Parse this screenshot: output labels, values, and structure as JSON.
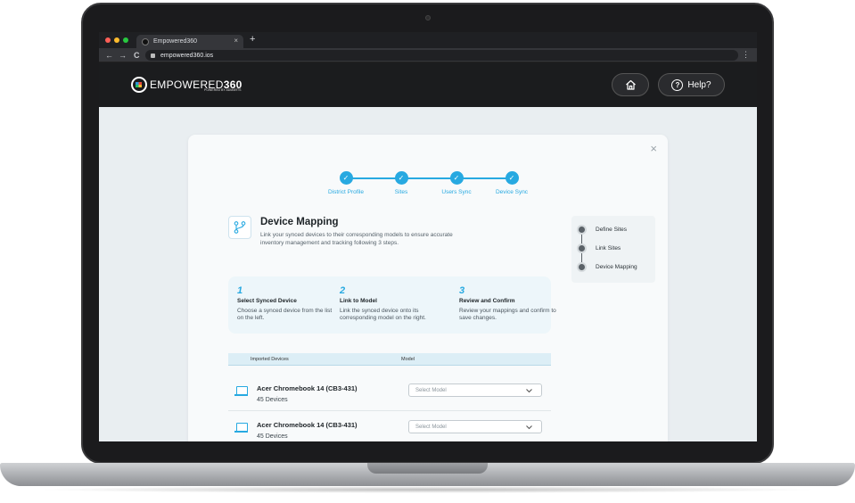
{
  "browser": {
    "tab_title": "Empowered360",
    "tab_close": "×",
    "new_tab": "+",
    "url": "empowered360.ios",
    "back": "←",
    "forward": "→",
    "reload": "C",
    "menu": "⋮",
    "traffic_light_colors": [
      "#ff5f57",
      "#febc2e",
      "#28c840"
    ]
  },
  "header": {
    "logo_text_light": "EMPOWERED",
    "logo_text_bold": "360",
    "logo_subtitle": "POWERED BY ADMARTS",
    "help_label": "Help?",
    "help_glyph": "?",
    "home_icon": "home-icon"
  },
  "modal": {
    "close_label": "×",
    "stepper": [
      {
        "label": "District Profile",
        "check": "✓"
      },
      {
        "label": "Sites",
        "check": "✓"
      },
      {
        "label": "Users Sync",
        "check": "✓"
      },
      {
        "label": "Device Sync",
        "check": "✓"
      }
    ],
    "title": "Device Mapping",
    "subtitle": "Link your synced devices to their corresponding models to ensure accurate inventory management and tracking following 3 steps.",
    "side_steps": [
      "Define Sites",
      "Link Sites",
      "Device Mapping"
    ],
    "instructions": [
      {
        "num": "1",
        "title": "Select Synced Device",
        "desc": "Choose a synced device from the list on the left."
      },
      {
        "num": "2",
        "title": "Link to Model",
        "desc": "Link the synced device onto its corresponding model on the right."
      },
      {
        "num": "3",
        "title": "Review and Confirm",
        "desc": "Review your mappings and confirm to save changes."
      }
    ],
    "table": {
      "col_devices": "Imported Devices",
      "col_model": "Model",
      "rows": [
        {
          "name": "Acer Chromebook 14 (CB3-431)",
          "count": "45 Devices",
          "select": "Select Model"
        },
        {
          "name": "Acer Chromebook 14 (CB3-431)",
          "count": "45 Devices",
          "select": "Select Model"
        }
      ]
    }
  },
  "colors": {
    "accent": "#27a9e1",
    "header_bg": "#1b1c1e",
    "page_bg": "#e9eef1"
  }
}
